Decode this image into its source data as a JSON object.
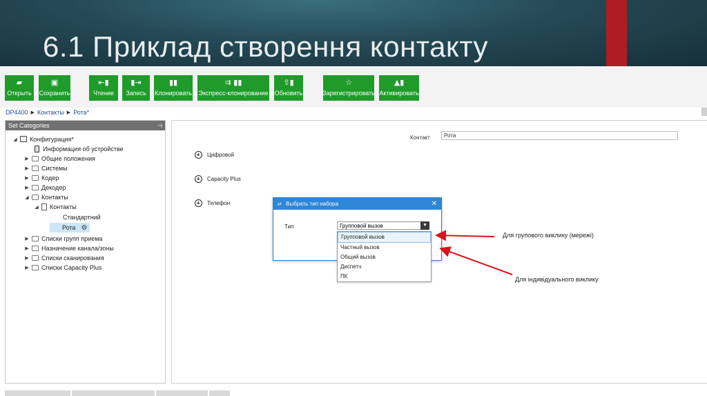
{
  "slide": {
    "title": "6.1 Приклад створення контакту"
  },
  "toolbar": {
    "open": "Открыть",
    "save": "Сохранить",
    "read": "Чтение",
    "write": "Запись",
    "clone": "Клонировать",
    "express_clone": "Экспресс-клонирование",
    "update": "Обновить",
    "register": "Зарегистрировать",
    "activate": "Активировать"
  },
  "breadcrumb": {
    "items": [
      "DP4400",
      "Контакты",
      "Рота*"
    ]
  },
  "left_panel": {
    "header": "Set Categories",
    "tree": {
      "configuration": "Конфигурация*",
      "device_info": "Информация об устройстве",
      "general": "Общие положения",
      "systems": "Системы",
      "coder": "Кодер",
      "decoder": "Декодер",
      "contacts": "Контакты",
      "contacts_sub": "Контакты",
      "standard": "Стандартний",
      "rota": "Рота",
      "rx_groups": "Списки групп приема",
      "channel_zones": "Назначение канала/зоны",
      "scan_lists": "Списки сканирования",
      "capacity_lists": "Списки Capacity Plus"
    }
  },
  "main_panel": {
    "contact_label": "Контакт",
    "contact_value": "Рота",
    "sections": [
      "Цифровой",
      "Capacity Plus",
      "Телефон"
    ]
  },
  "dialog": {
    "title": "Выбрать тип набора",
    "type_label": "Тип",
    "selected": "Групповой вызов",
    "options": [
      "Групповой вызов",
      "Частный вызов",
      "Общий вызов",
      "Диспетч",
      "ПК"
    ]
  },
  "annotations": {
    "group_call": "Для групового виклику (мережі)",
    "individual_call": "Для індивідуального виклику"
  },
  "colors": {
    "toolbar_green": "#1f9b2a",
    "dialog_blue": "#2e86d6",
    "arrow_red": "#d8141c",
    "slide_accent": "#b01c22"
  }
}
